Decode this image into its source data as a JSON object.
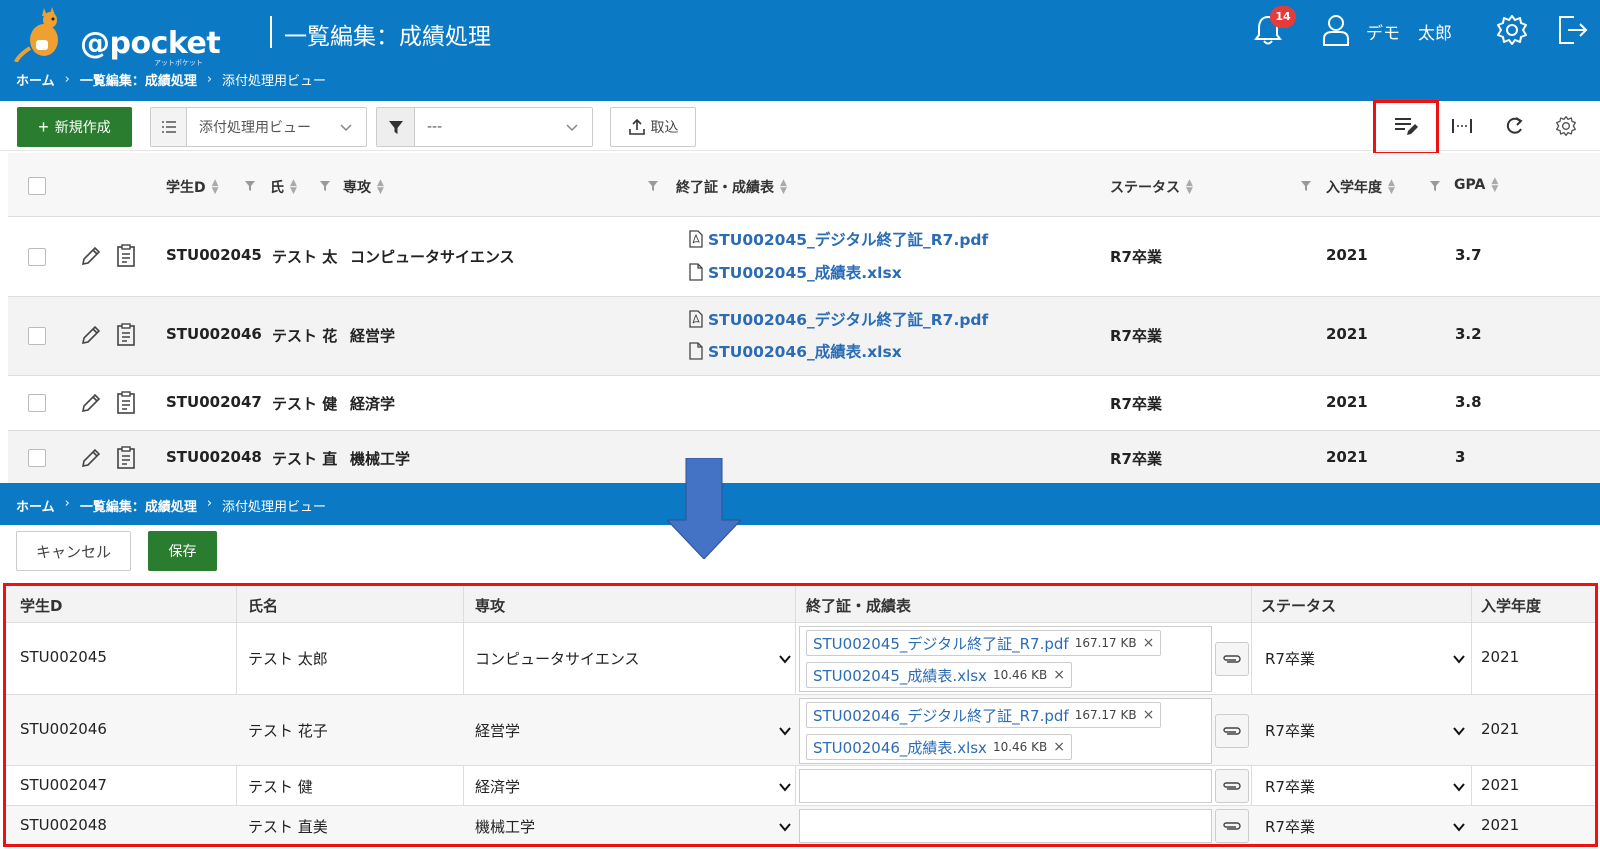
{
  "app": {
    "logo_text": "@pocket",
    "logo_sub": "アットポケット",
    "page_title": "一覧編集：成績処理",
    "notification_count": "14",
    "user_first": "デモ",
    "user_last": "太郎"
  },
  "breadcrumb": {
    "home": "ホーム",
    "mid": "一覧編集：成績処理",
    "current": "添付処理用ビュー",
    "sep": "›"
  },
  "toolbar": {
    "new_label": "新規作成",
    "view_value": "添付処理用ビュー",
    "filter_value": "---",
    "import_label": "取込"
  },
  "list": {
    "headers": {
      "id": "学生D",
      "name": "氏",
      "major": "専攻",
      "files": "終了証・成績表",
      "status": "ステータス",
      "year": "入学年度",
      "gpa": "GPA"
    },
    "rows": [
      {
        "id": "STU002045",
        "name": "テスト 太",
        "major": "コンピュータサイエンス",
        "file1": "STU002045_デジタル終了証_R7.pdf",
        "file2": "STU002045_成績表.xlsx",
        "status": "R7卒業",
        "year": "2021",
        "gpa": "3.7"
      },
      {
        "id": "STU002046",
        "name": "テスト 花",
        "major": "経営学",
        "file1": "STU002046_デジタル終了証_R7.pdf",
        "file2": "STU002046_成績表.xlsx",
        "status": "R7卒業",
        "year": "2021",
        "gpa": "3.2"
      },
      {
        "id": "STU002047",
        "name": "テスト 健",
        "major": "経済学",
        "status": "R7卒業",
        "year": "2021",
        "gpa": "3.8"
      },
      {
        "id": "STU002048",
        "name": "テスト 直",
        "major": "機械工学",
        "status": "R7卒業",
        "year": "2021",
        "gpa": "3"
      }
    ]
  },
  "edit": {
    "cancel_label": "キャンセル",
    "save_label": "保存",
    "headers": {
      "id": "学生D",
      "name": "氏名",
      "major": "専攻",
      "files": "終了証・成績表",
      "status": "ステータス",
      "year": "入学年度"
    },
    "rows": [
      {
        "id": "STU002045",
        "name": "テスト 太郎",
        "major": "コンピュータサイエンス",
        "file1": "STU002045_デジタル終了証_R7.pdf",
        "file1_size": "167.17 KB",
        "file2": "STU002045_成績表.xlsx",
        "file2_size": "10.46 KB",
        "status": "R7卒業",
        "year": "2021"
      },
      {
        "id": "STU002046",
        "name": "テスト 花子",
        "major": "経営学",
        "file1": "STU002046_デジタル終了証_R7.pdf",
        "file1_size": "167.17 KB",
        "file2": "STU002046_成績表.xlsx",
        "file2_size": "10.46 KB",
        "status": "R7卒業",
        "year": "2021"
      },
      {
        "id": "STU002047",
        "name": "テスト 健",
        "major": "経済学",
        "status": "R7卒業",
        "year": "2021"
      },
      {
        "id": "STU002048",
        "name": "テスト 直美",
        "major": "機械工学",
        "status": "R7卒業",
        "year": "2021"
      }
    ],
    "remove_glyph": "×"
  },
  "colors": {
    "header_blue": "#0b79c3",
    "primary_green": "#2a7d2e",
    "link_blue": "#2b6cb5",
    "highlight_red": "#ee1111"
  }
}
